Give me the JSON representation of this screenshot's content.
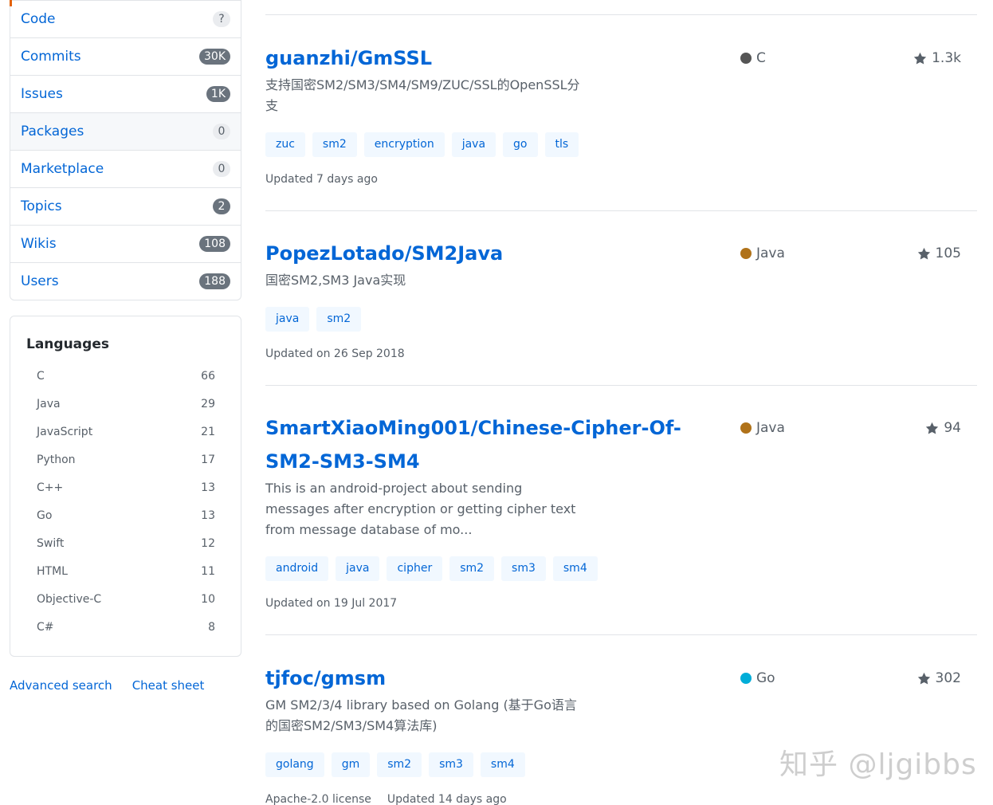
{
  "sidebar": {
    "filters": [
      {
        "label": "Code",
        "count": "?",
        "style": "light"
      },
      {
        "label": "Commits",
        "count": "30K",
        "style": "dark"
      },
      {
        "label": "Issues",
        "count": "1K",
        "style": "dark"
      },
      {
        "label": "Packages",
        "count": "0",
        "style": "light"
      },
      {
        "label": "Marketplace",
        "count": "0",
        "style": "light"
      },
      {
        "label": "Topics",
        "count": "2",
        "style": "dark"
      },
      {
        "label": "Wikis",
        "count": "108",
        "style": "dark"
      },
      {
        "label": "Users",
        "count": "188",
        "style": "dark"
      }
    ],
    "languages_title": "Languages",
    "languages": [
      {
        "name": "C",
        "count": "66"
      },
      {
        "name": "Java",
        "count": "29"
      },
      {
        "name": "JavaScript",
        "count": "21"
      },
      {
        "name": "Python",
        "count": "17"
      },
      {
        "name": "C++",
        "count": "13"
      },
      {
        "name": "Go",
        "count": "13"
      },
      {
        "name": "Swift",
        "count": "12"
      },
      {
        "name": "HTML",
        "count": "11"
      },
      {
        "name": "Objective-C",
        "count": "10"
      },
      {
        "name": "C#",
        "count": "8"
      }
    ],
    "advanced_search": "Advanced search",
    "cheat_sheet": "Cheat sheet"
  },
  "results": [
    {
      "title": "guanzhi/GmSSL",
      "description": "支持国密SM2/SM3/SM4/SM9/ZUC/SSL的OpenSSL分支",
      "language": "C",
      "language_color": "#555555",
      "stars": "1.3k",
      "topics": [
        "zuc",
        "sm2",
        "encryption",
        "java",
        "go",
        "tls"
      ],
      "license": "",
      "updated": "Updated 7 days ago"
    },
    {
      "title": "PopezLotado/SM2Java",
      "description": "国密SM2,SM3 Java实现",
      "language": "Java",
      "language_color": "#b07219",
      "stars": "105",
      "topics": [
        "java",
        "sm2"
      ],
      "license": "",
      "updated": "Updated on 26 Sep 2018"
    },
    {
      "title": "SmartXiaoMing001/Chinese-Cipher-Of-SM2-SM3-SM4",
      "description": "This is an android-project about sending messages after encryption or getting cipher text from message database of mo...",
      "language": "Java",
      "language_color": "#b07219",
      "stars": "94",
      "topics": [
        "android",
        "java",
        "cipher",
        "sm2",
        "sm3",
        "sm4"
      ],
      "license": "",
      "updated": "Updated on 19 Jul 2017"
    },
    {
      "title": "tjfoc/gmsm",
      "description": "GM SM2/3/4 library based on Golang (基于Go语言的国密SM2/SM3/SM4算法库)",
      "language": "Go",
      "language_color": "#00ADD8",
      "stars": "302",
      "topics": [
        "golang",
        "gm",
        "sm2",
        "sm3",
        "sm4"
      ],
      "license": "Apache-2.0 license",
      "updated": "Updated 14 days ago"
    }
  ],
  "watermark": "知乎 @ljgibbs"
}
